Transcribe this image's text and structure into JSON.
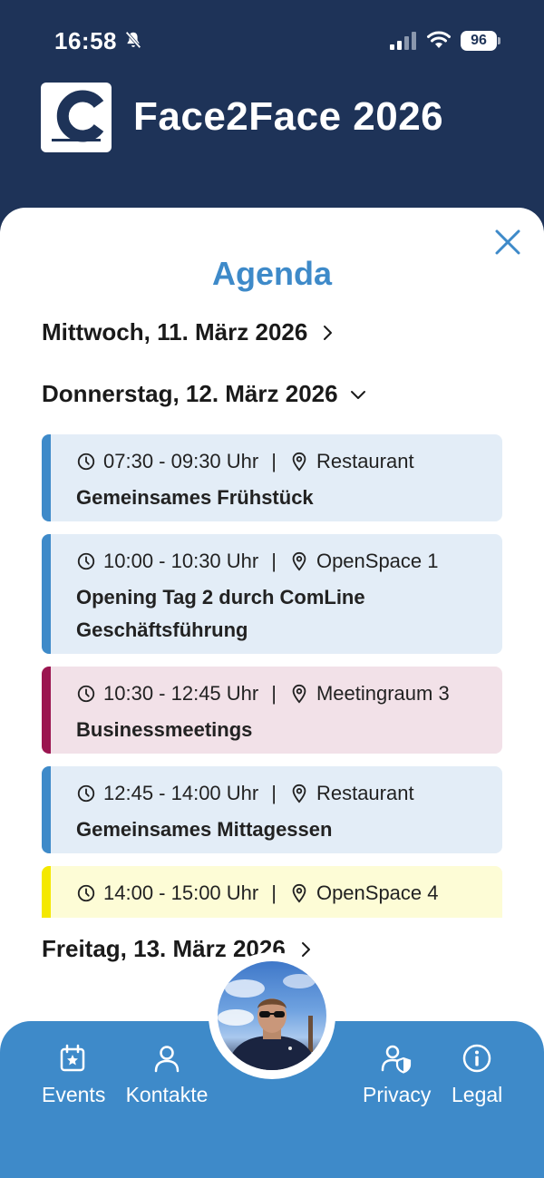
{
  "status": {
    "time": "16:58",
    "battery": "96"
  },
  "header": {
    "title": "Face2Face 2026"
  },
  "sheet": {
    "title": "Agenda"
  },
  "days": [
    {
      "label": "Mittwoch, 11. März 2026",
      "state": "collapsed"
    },
    {
      "label": "Donnerstag, 12. März 2026",
      "state": "expanded"
    },
    {
      "label": "Freitag, 13. März 2026",
      "state": "collapsed"
    }
  ],
  "events": [
    {
      "time": "07:30 - 09:30 Uhr",
      "separator": "|",
      "location": "Restaurant",
      "title": "Gemeinsames Frühstück",
      "accent": "#3e8ac9",
      "bg": "#e3edf7"
    },
    {
      "time": "10:00 - 10:30 Uhr",
      "separator": "|",
      "location": "OpenSpace 1",
      "title_line1": "Opening Tag 2 durch ComLine",
      "title_line2": "Geschäftsführung",
      "accent": "#3e8ac9",
      "bg": "#e3edf7"
    },
    {
      "time": "10:30 - 12:45 Uhr",
      "separator": "|",
      "location": "Meetingraum 3",
      "title": "Businessmeetings",
      "accent": "#9b1550",
      "bg": "#f2e1e8"
    },
    {
      "time": "12:45 - 14:00 Uhr",
      "separator": "|",
      "location": "Restaurant",
      "title": "Gemeinsames Mittagessen",
      "accent": "#3e8ac9",
      "bg": "#e3edf7"
    },
    {
      "time": "14:00 - 15:00 Uhr",
      "separator": "|",
      "location": "OpenSpace 4",
      "accent": "#f4e800",
      "bg": "#fdfcd6"
    }
  ],
  "nav": {
    "events": "Events",
    "contacts": "Kontakte",
    "privacy": "Privacy",
    "legal": "Legal"
  },
  "icons": [
    "bell-muted-icon",
    "signal-icon",
    "wifi-icon",
    "close-icon",
    "chevron-right-icon",
    "chevron-down-icon",
    "clock-icon",
    "location-pin-icon",
    "calendar-star-icon",
    "person-icon",
    "person-shield-icon",
    "info-icon"
  ]
}
